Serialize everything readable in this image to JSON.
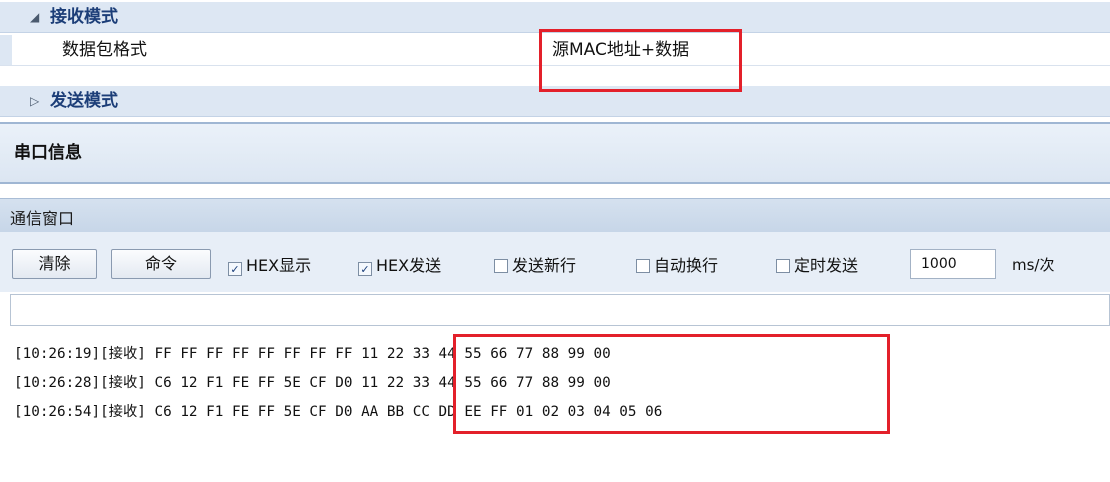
{
  "properties": {
    "receive_category": "接收模式",
    "packet_format_label": "数据包格式",
    "packet_format_value": "源MAC地址+数据",
    "send_category": "发送模式"
  },
  "serial_info": {
    "title": "串口信息"
  },
  "comm_window": {
    "title": "通信窗口",
    "toolbar": {
      "clear_label": "清除",
      "command_label": "命令",
      "hex_display_label": "HEX显示",
      "hex_display_checked": true,
      "hex_send_label": "HEX发送",
      "hex_send_checked": true,
      "send_newline_label": "发送新行",
      "send_newline_checked": false,
      "auto_wrap_label": "自动换行",
      "auto_wrap_checked": false,
      "timed_send_label": "定时发送",
      "timed_send_checked": false,
      "interval_value": "1000",
      "interval_unit": "ms/次"
    },
    "send_input_value": "",
    "log": [
      {
        "prefix": "[10:26:19][接收] FF FF FF FF FF FF FF FF ",
        "payload": "11 22 33 44 55 66 77 88 99 00"
      },
      {
        "prefix": "[10:26:28][接收] C6 12 F1 FE FF 5E CF D0 ",
        "payload": "11 22 33 44 55 66 77 88 99 00"
      },
      {
        "prefix": "[10:26:54][接收] C6 12 F1 FE FF 5E CF D0 ",
        "payload": "AA BB CC DD EE FF 01 02 03 04 05 06"
      }
    ]
  },
  "colors": {
    "highlight": "#e3202a",
    "category_text": "#1c3e78"
  }
}
